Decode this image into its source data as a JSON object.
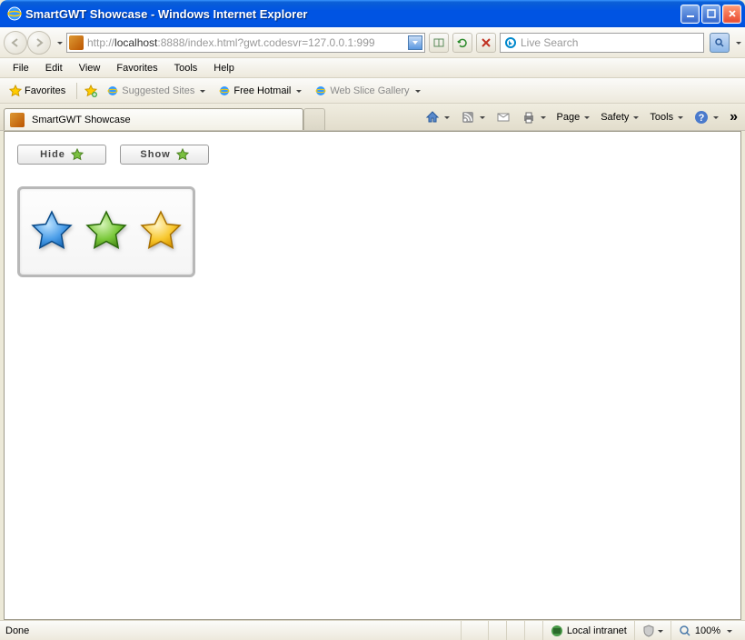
{
  "window": {
    "title": "SmartGWT Showcase - Windows Internet Explorer"
  },
  "nav": {
    "url_prefix": "http://",
    "url_host": "localhost",
    "url_rest": ":8888/index.html?gwt.codesvr=127.0.0.1:999",
    "search_placeholder": "Live Search"
  },
  "menu": {
    "file": "File",
    "edit": "Edit",
    "view": "View",
    "favorites": "Favorites",
    "tools": "Tools",
    "help": "Help"
  },
  "favbar": {
    "favorites": "Favorites",
    "suggested": "Suggested Sites",
    "hotmail": "Free Hotmail",
    "webslice": "Web Slice Gallery"
  },
  "tabs": {
    "active": "SmartGWT Showcase"
  },
  "toolbar": {
    "page": "Page",
    "safety": "Safety",
    "tools": "Tools"
  },
  "content": {
    "hide": "Hide",
    "show": "Show"
  },
  "status": {
    "done": "Done",
    "zone": "Local intranet",
    "zoom": "100%"
  }
}
